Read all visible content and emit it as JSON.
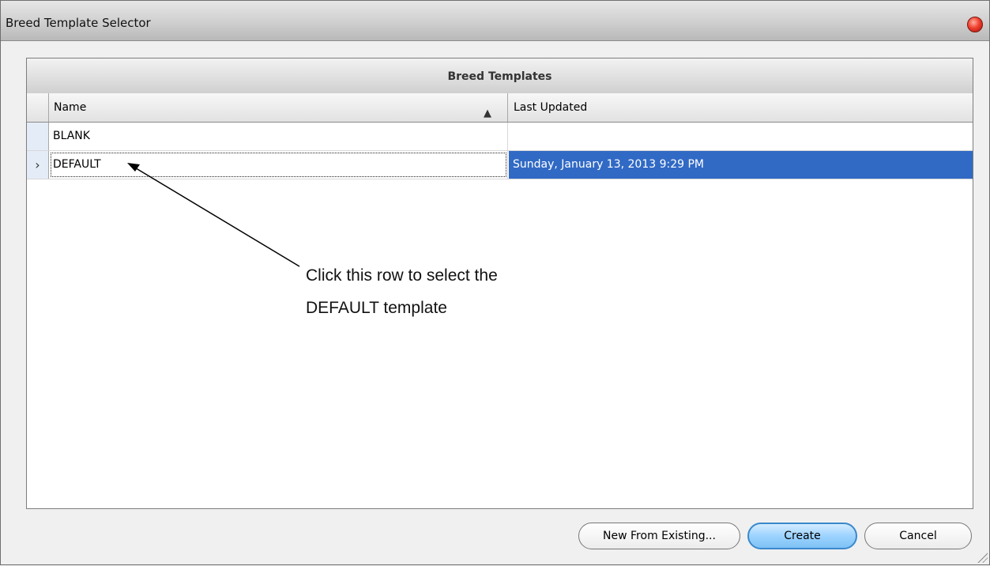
{
  "window": {
    "title": "Breed Template Selector"
  },
  "grid": {
    "group_title": "Breed Templates",
    "columns": {
      "name": "Name",
      "last_updated": "Last Updated"
    },
    "sort_icon": "sort-ascending-icon",
    "rows": [
      {
        "indicator": "",
        "name": "BLANK",
        "last_updated": ""
      },
      {
        "indicator": "›",
        "name": "DEFAULT",
        "last_updated": "Sunday, January 13, 2013 9:29 PM"
      }
    ],
    "selected_row": 1,
    "selection_color": "#316ac5"
  },
  "annotation": {
    "text": "Click this row to select the\nDEFAULT template"
  },
  "buttons": {
    "new_from_existing": "New From Existing...",
    "create": "Create",
    "cancel": "Cancel"
  }
}
